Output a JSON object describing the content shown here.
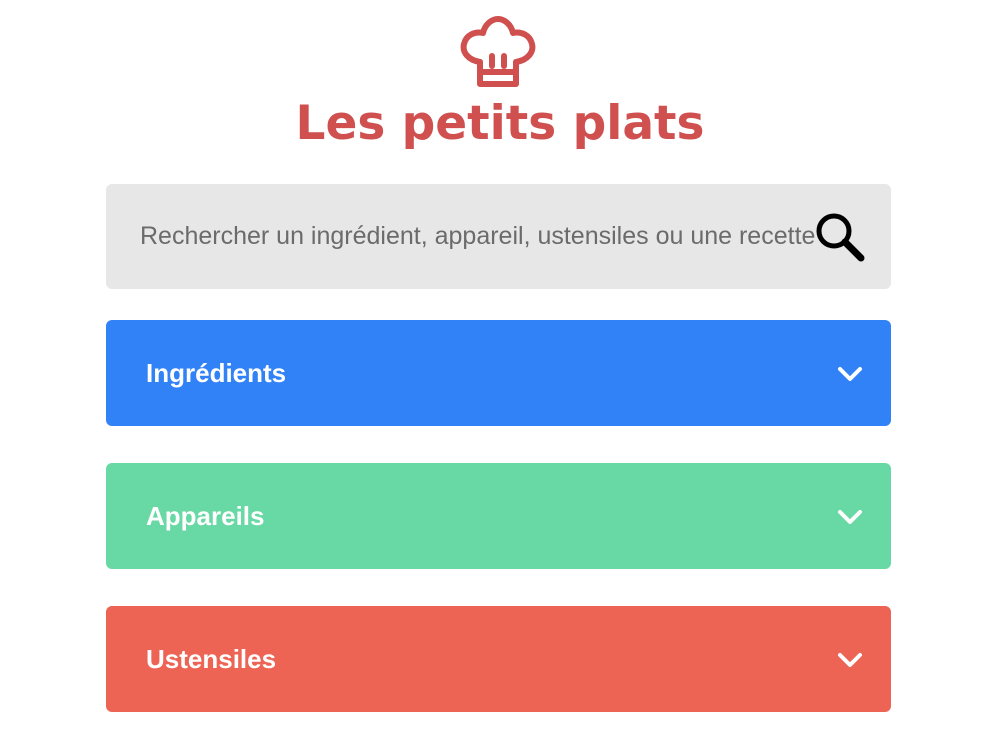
{
  "header": {
    "logo_icon": "chef-hat-icon",
    "title": "Les petits plats"
  },
  "search": {
    "placeholder": "Rechercher un ingrédient, appareil, ustensiles ou une recette",
    "value": "",
    "button_icon": "search-icon"
  },
  "filters": [
    {
      "label": "Ingrédients",
      "color": "#3282F7",
      "icon": "chevron-down-icon"
    },
    {
      "label": "Appareils",
      "color": "#68D9A4",
      "icon": "chevron-down-icon"
    },
    {
      "label": "Ustensiles",
      "color": "#ED6454",
      "icon": "chevron-down-icon"
    }
  ],
  "colors": {
    "brand": "#D04F4F",
    "search_background": "#E7E7E7",
    "search_icon": "#000000"
  }
}
